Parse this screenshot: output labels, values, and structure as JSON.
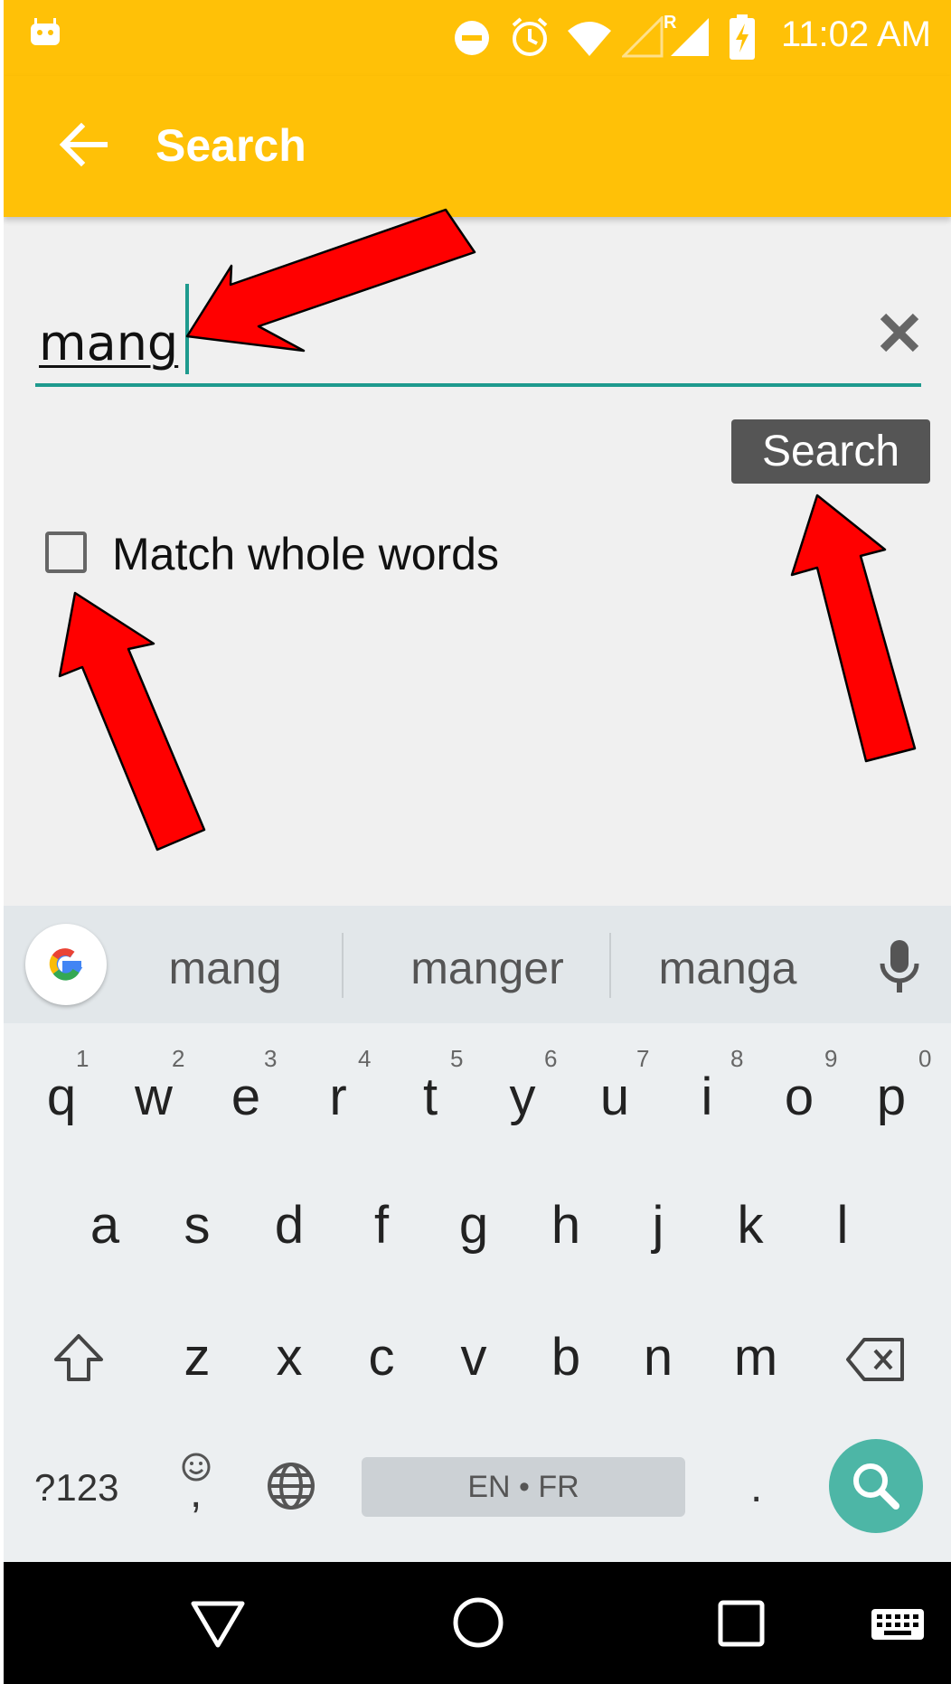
{
  "colors": {
    "appbar": "#ffc107",
    "accent": "#1e9a8e",
    "search_key": "#4db6a6",
    "button": "#555555",
    "arrow": "#ff0000"
  },
  "status_bar": {
    "time": "11:02 AM",
    "icons": [
      "android-icon",
      "dnd-icon",
      "alarm-icon",
      "wifi-icon",
      "signal-roaming-icon",
      "signal-icon",
      "battery-charging-icon"
    ],
    "roaming_label": "R"
  },
  "app_bar": {
    "title": "Search",
    "back_icon": "arrow-left-icon"
  },
  "search": {
    "query": "mang",
    "clear_icon": "close-icon",
    "button_label": "Search"
  },
  "options": {
    "match_whole_words_label": "Match whole words",
    "match_whole_words_checked": false
  },
  "keyboard": {
    "suggestions": [
      "mang",
      "manger",
      "manga"
    ],
    "row1": [
      "q",
      "w",
      "e",
      "r",
      "t",
      "y",
      "u",
      "i",
      "o",
      "p"
    ],
    "row1_hints": [
      "1",
      "2",
      "3",
      "4",
      "5",
      "6",
      "7",
      "8",
      "9",
      "0"
    ],
    "row2": [
      "a",
      "s",
      "d",
      "f",
      "g",
      "h",
      "j",
      "k",
      "l"
    ],
    "row3": [
      "z",
      "x",
      "c",
      "v",
      "b",
      "n",
      "m"
    ],
    "symbols_label": "?123",
    "emoji_comma": ",",
    "period": ".",
    "space_label": "EN • FR"
  }
}
